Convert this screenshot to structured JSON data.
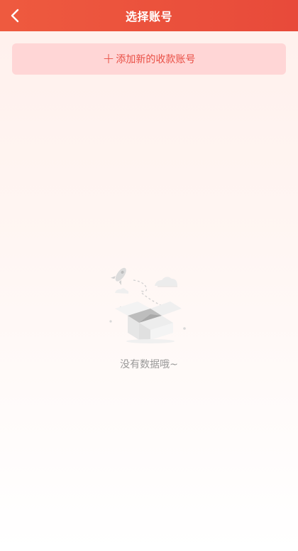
{
  "header": {
    "title": "选择账号",
    "back_icon": "chevron-left-icon"
  },
  "add_account": {
    "icon": "plus-icon",
    "label": "添加新的收款账号",
    "color": "#e94f45"
  },
  "empty_state": {
    "illustration": "empty-box-icon",
    "message": "没有数据哦~"
  },
  "colors": {
    "header": "#e84a3a",
    "button_bg": "#ffd6d6"
  }
}
